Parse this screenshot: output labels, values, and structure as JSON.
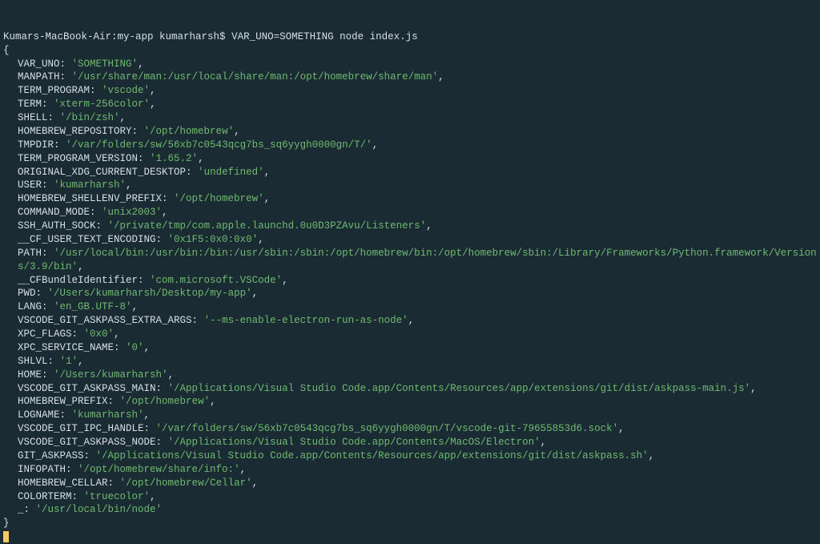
{
  "prompt": "Kumars-MacBook-Air:my-app kumarharsh$",
  "command": "VAR_UNO=SOMETHING node index.js",
  "open_brace": "{",
  "close_brace": "}",
  "env": [
    {
      "key": "VAR_UNO",
      "value": "'SOMETHING'"
    },
    {
      "key": "MANPATH",
      "value": "'/usr/share/man:/usr/local/share/man:/opt/homebrew/share/man'"
    },
    {
      "key": "TERM_PROGRAM",
      "value": "'vscode'"
    },
    {
      "key": "TERM",
      "value": "'xterm-256color'"
    },
    {
      "key": "SHELL",
      "value": "'/bin/zsh'"
    },
    {
      "key": "HOMEBREW_REPOSITORY",
      "value": "'/opt/homebrew'"
    },
    {
      "key": "TMPDIR",
      "value": "'/var/folders/sw/56xb7c0543qcg7bs_sq6yygh0000gn/T/'"
    },
    {
      "key": "TERM_PROGRAM_VERSION",
      "value": "'1.65.2'"
    },
    {
      "key": "ORIGINAL_XDG_CURRENT_DESKTOP",
      "value": "'undefined'"
    },
    {
      "key": "USER",
      "value": "'kumarharsh'"
    },
    {
      "key": "HOMEBREW_SHELLENV_PREFIX",
      "value": "'/opt/homebrew'"
    },
    {
      "key": "COMMAND_MODE",
      "value": "'unix2003'"
    },
    {
      "key": "SSH_AUTH_SOCK",
      "value": "'/private/tmp/com.apple.launchd.0u0D3PZAvu/Listeners'"
    },
    {
      "key": "__CF_USER_TEXT_ENCODING",
      "value": "'0x1F5:0x0:0x0'"
    },
    {
      "key": "PATH",
      "value": "'/usr/local/bin:/usr/bin:/bin:/usr/sbin:/sbin:/opt/homebrew/bin:/opt/homebrew/sbin:/Library/Frameworks/Python.framework/Versions/3.9/bin'"
    },
    {
      "key": "__CFBundleIdentifier",
      "value": "'com.microsoft.VSCode'"
    },
    {
      "key": "PWD",
      "value": "'/Users/kumarharsh/Desktop/my-app'"
    },
    {
      "key": "LANG",
      "value": "'en_GB.UTF-8'"
    },
    {
      "key": "VSCODE_GIT_ASKPASS_EXTRA_ARGS",
      "value": "'--ms-enable-electron-run-as-node'"
    },
    {
      "key": "XPC_FLAGS",
      "value": "'0x0'"
    },
    {
      "key": "XPC_SERVICE_NAME",
      "value": "'0'"
    },
    {
      "key": "SHLVL",
      "value": "'1'"
    },
    {
      "key": "HOME",
      "value": "'/Users/kumarharsh'"
    },
    {
      "key": "VSCODE_GIT_ASKPASS_MAIN",
      "value": "'/Applications/Visual Studio Code.app/Contents/Resources/app/extensions/git/dist/askpass-main.js'"
    },
    {
      "key": "HOMEBREW_PREFIX",
      "value": "'/opt/homebrew'"
    },
    {
      "key": "LOGNAME",
      "value": "'kumarharsh'"
    },
    {
      "key": "VSCODE_GIT_IPC_HANDLE",
      "value": "'/var/folders/sw/56xb7c0543qcg7bs_sq6yygh0000gn/T/vscode-git-79655853d6.sock'"
    },
    {
      "key": "VSCODE_GIT_ASKPASS_NODE",
      "value": "'/Applications/Visual Studio Code.app/Contents/MacOS/Electron'"
    },
    {
      "key": "GIT_ASKPASS",
      "value": "'/Applications/Visual Studio Code.app/Contents/Resources/app/extensions/git/dist/askpass.sh'"
    },
    {
      "key": "INFOPATH",
      "value": "'/opt/homebrew/share/info:'"
    },
    {
      "key": "HOMEBREW_CELLAR",
      "value": "'/opt/homebrew/Cellar'"
    },
    {
      "key": "COLORTERM",
      "value": "'truecolor'"
    },
    {
      "key": "_",
      "value": "'/usr/local/bin/node'"
    }
  ]
}
